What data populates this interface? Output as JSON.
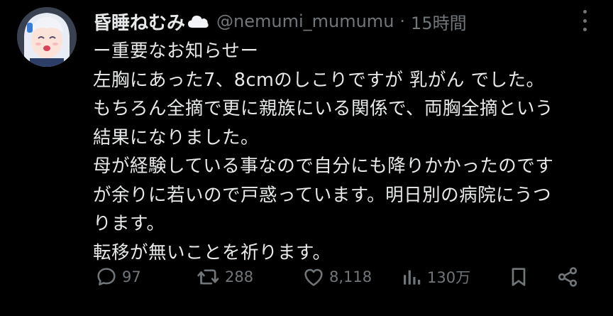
{
  "user": {
    "display_name": "昏睡ねむみ",
    "name_emoji": "cloud-emoji",
    "handle": "@nemumi_mumumu",
    "separator": "·",
    "time": "15時間"
  },
  "body_lines": [
    "ー重要なお知らせー",
    "左胸にあった7、8cmのしこりですが 乳がん でした。",
    "もちろん全摘で更に親族にいる関係で、両胸全摘という",
    "結果になりました。",
    "母が経験している事なので自分にも降りかかったのです",
    "が余りに若いので戸惑っています。明日別の病院にうつ",
    "ります。",
    "転移が無いことを祈ります。"
  ],
  "actions": {
    "replies": {
      "icon": "reply-icon",
      "count": "97"
    },
    "reposts": {
      "icon": "repost-icon",
      "count": "288"
    },
    "likes": {
      "icon": "heart-icon",
      "count": "8,118"
    },
    "views": {
      "icon": "views-icon",
      "count": "130万"
    },
    "bookmark": {
      "icon": "bookmark-icon"
    },
    "share": {
      "icon": "share-icon"
    }
  },
  "colors": {
    "background": "#000000",
    "text": "#e7e9ea",
    "secondary": "#71767b"
  }
}
